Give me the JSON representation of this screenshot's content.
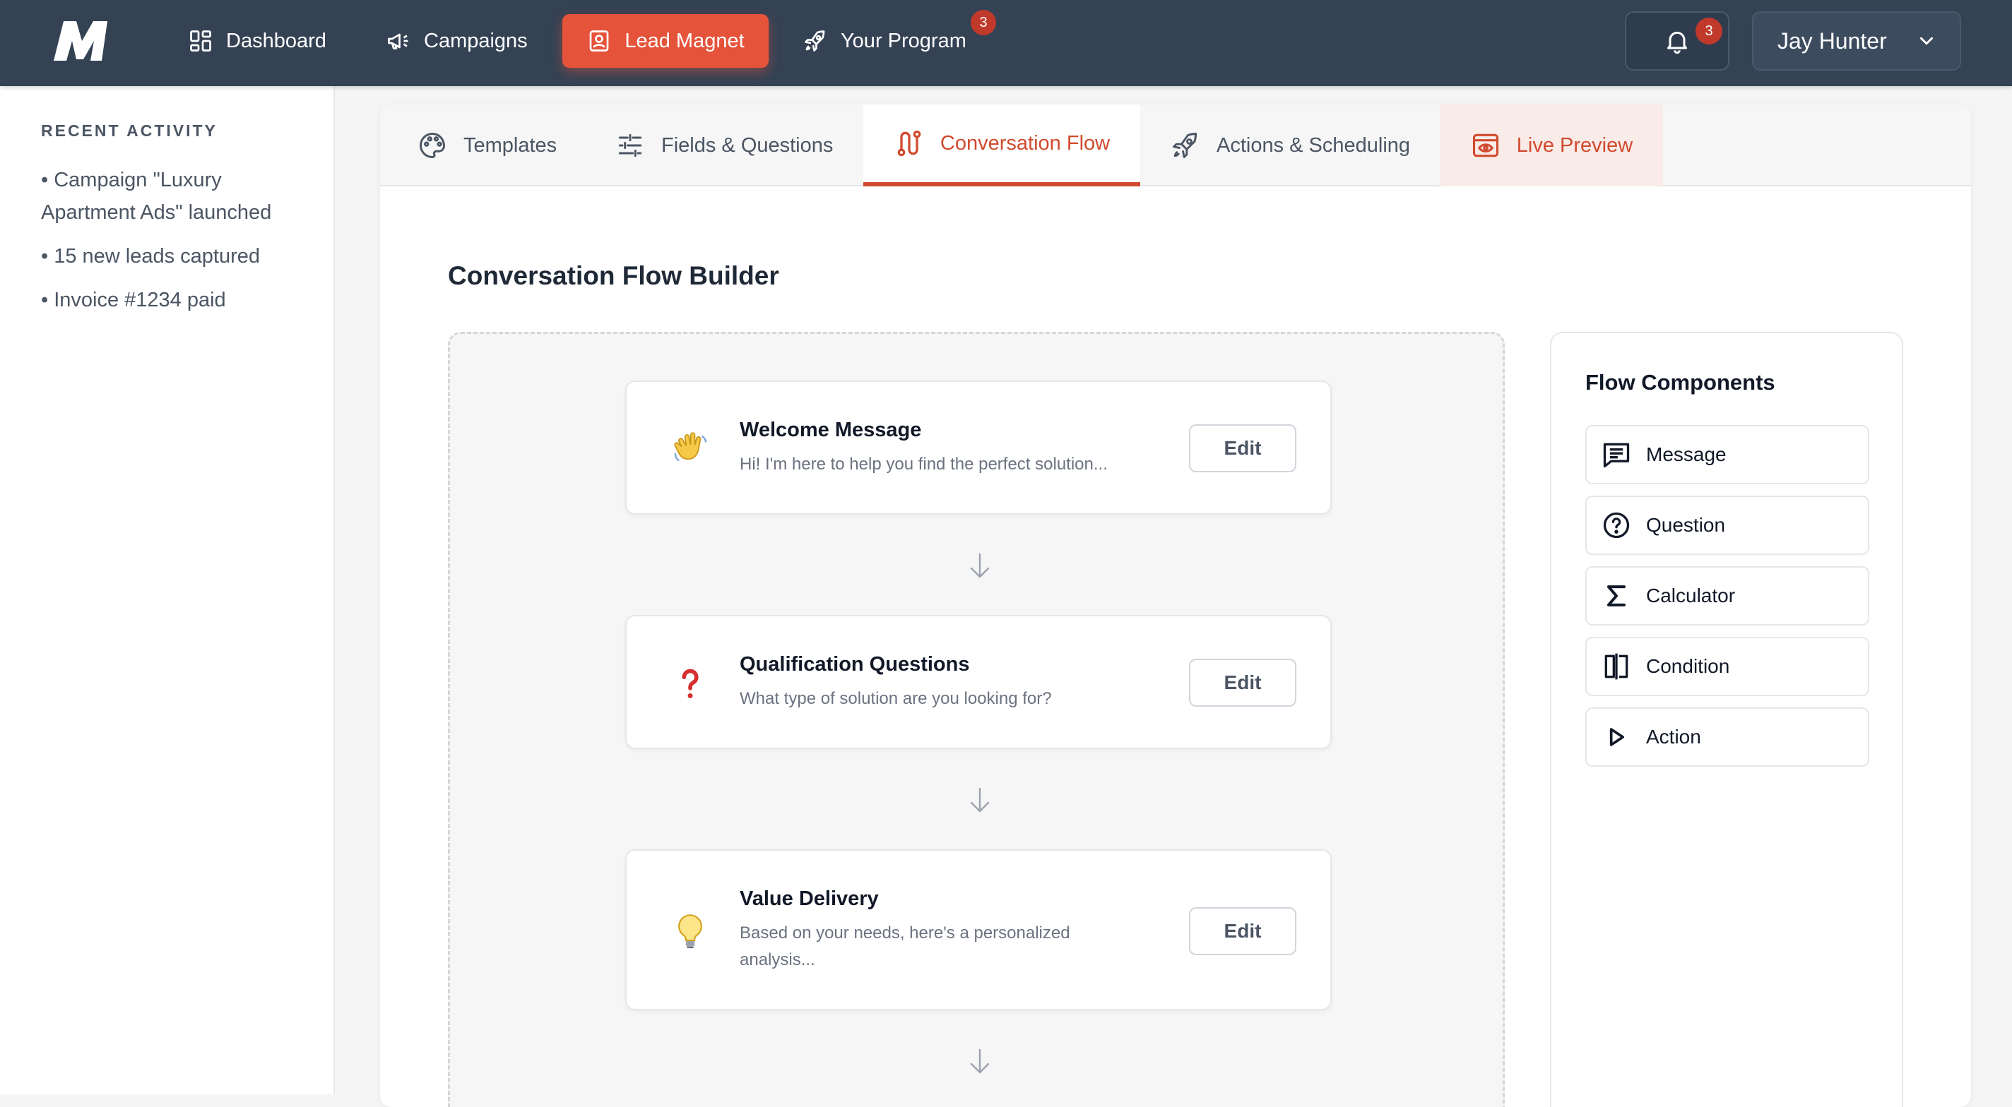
{
  "nav": {
    "items": [
      {
        "label": "Dashboard",
        "icon": "dashboard-icon"
      },
      {
        "label": "Campaigns",
        "icon": "megaphone-icon"
      },
      {
        "label": "Lead Magnet",
        "icon": "contact-card-icon",
        "active": true
      },
      {
        "label": "Your Program",
        "icon": "rocket-icon",
        "badge": "3"
      }
    ],
    "notifications_badge": "3",
    "user_name": "Jay Hunter"
  },
  "sidebar": {
    "heading": "RECENT ACTIVITY",
    "items": [
      "• Campaign \"Luxury Apartment Ads\" launched",
      "• 15 new leads captured",
      "• Invoice #1234 paid"
    ]
  },
  "tabs": [
    {
      "label": "Templates",
      "icon": "palette-icon"
    },
    {
      "label": "Fields & Questions",
      "icon": "sliders-icon"
    },
    {
      "label": "Conversation Flow",
      "icon": "route-icon",
      "active": true
    },
    {
      "label": "Actions & Scheduling",
      "icon": "rocket-icon"
    },
    {
      "label": "Live Preview",
      "icon": "preview-eye-icon"
    }
  ],
  "builder": {
    "title": "Conversation Flow Builder",
    "steps": [
      {
        "title": "Welcome Message",
        "description": "Hi! I'm here to help you find the perfect solution...",
        "icon": "waving-hand-icon",
        "edit_label": "Edit"
      },
      {
        "title": "Qualification Questions",
        "description": "What type of solution are you looking for?",
        "icon": "question-mark-icon",
        "edit_label": "Edit"
      },
      {
        "title": "Value Delivery",
        "description": "Based on your needs, here's a personalized analysis...",
        "icon": "lightbulb-icon",
        "edit_label": "Edit"
      }
    ]
  },
  "components": {
    "title": "Flow Components",
    "items": [
      {
        "label": "Message",
        "icon": "message-icon"
      },
      {
        "label": "Question",
        "icon": "question-circle-icon"
      },
      {
        "label": "Calculator",
        "icon": "sigma-icon"
      },
      {
        "label": "Condition",
        "icon": "split-panel-icon"
      },
      {
        "label": "Action",
        "icon": "play-icon"
      }
    ]
  },
  "colors": {
    "topbar": "#344254",
    "accent": "#e5533a",
    "accent_text": "#d14a2e",
    "badge": "#c0392b"
  }
}
